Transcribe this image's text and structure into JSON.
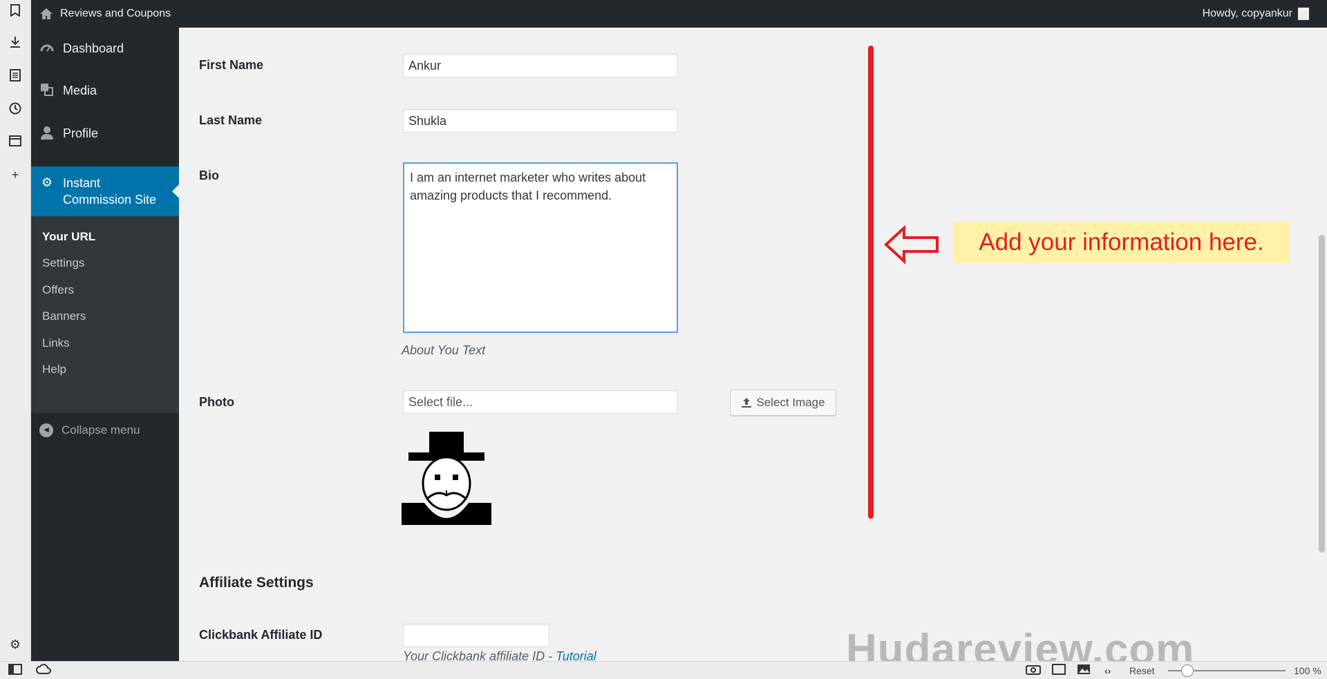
{
  "adminbar": {
    "site_title": "Reviews and Coupons",
    "howdy": "Howdy, copyankur"
  },
  "sidebar": {
    "items": [
      {
        "label": "Dashboard",
        "icon": "dashboard-icon"
      },
      {
        "label": "Media",
        "icon": "media-icon"
      },
      {
        "label": "Profile",
        "icon": "profile-icon"
      },
      {
        "label": "Instant\nCommission Site",
        "icon": "gear-icon"
      }
    ],
    "submenu": [
      "Your URL",
      "Settings",
      "Offers",
      "Banners",
      "Links",
      "Help"
    ],
    "collapse": "Collapse menu"
  },
  "form": {
    "first_name_label": "First Name",
    "first_name": "Ankur",
    "last_name_label": "Last Name",
    "last_name": "Shukla",
    "bio_label": "Bio",
    "bio": "I am an internet marketer who writes about amazing products that I recommend.",
    "bio_desc": "About You Text",
    "photo_label": "Photo",
    "photo_placeholder": "Select file...",
    "select_image": "Select Image",
    "affiliate_title": "Affiliate Settings",
    "clickbank_label": "Clickbank Affiliate ID",
    "clickbank_value": "",
    "clickbank_desc": "Your Clickbank affiliate ID - ",
    "clickbank_link": "Tutorial"
  },
  "annotation": {
    "callout": "Add your information here."
  },
  "watermark": "Hudareview.com",
  "statusbar": {
    "reset": "Reset",
    "zoom": "100 %"
  },
  "colors": {
    "accent": "#0073aa",
    "annotation": "#e31e24",
    "callout_bg": "#fff2a8"
  }
}
